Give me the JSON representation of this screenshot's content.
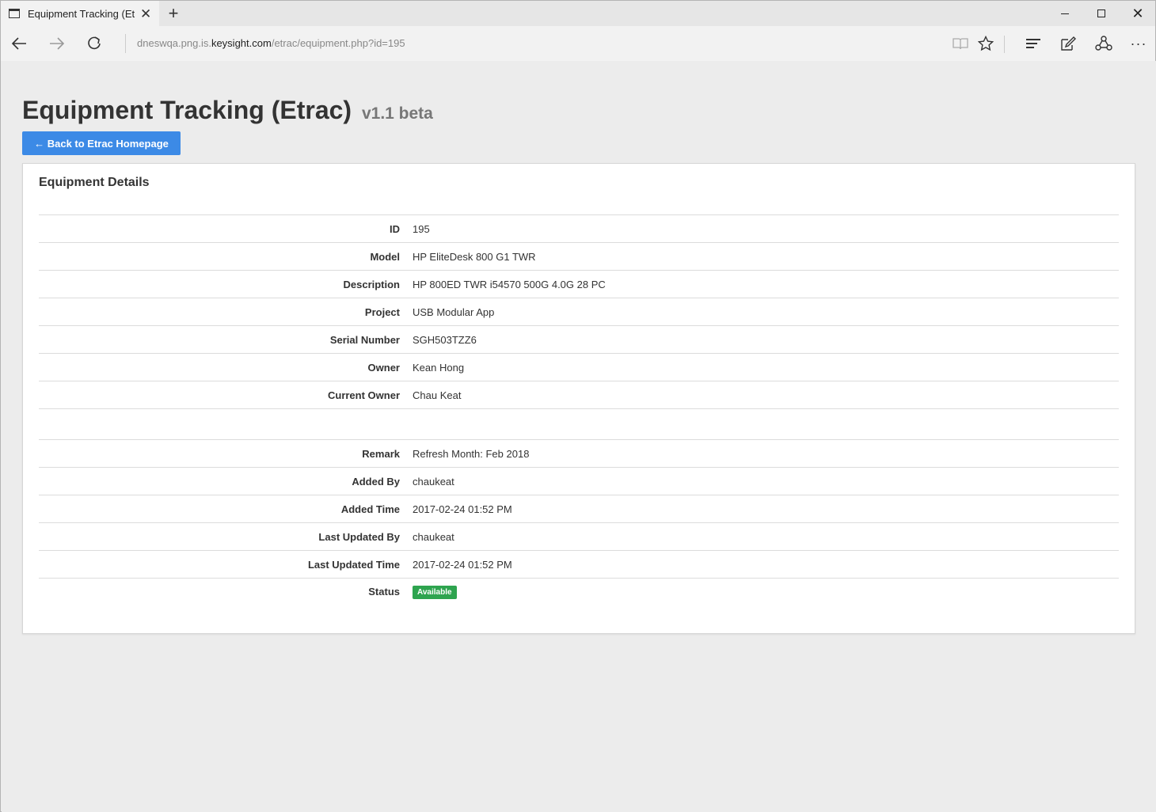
{
  "browser": {
    "tab_title": "Equipment Tracking (Etr",
    "tab_close": "✕",
    "new_tab": "+",
    "url_prefix": "dneswqa.png.is.",
    "url_domain": "keysight.com",
    "url_path": "/etrac/equipment.php?id=195"
  },
  "header": {
    "title": "Equipment Tracking (Etrac)",
    "version": "v1.1 beta",
    "back_button": "← Back to Etrac Homepage"
  },
  "panel": {
    "title": "Equipment Details",
    "rows": [
      {
        "label": "ID",
        "value": "195"
      },
      {
        "label": "Model",
        "value": "HP EliteDesk 800 G1 TWR"
      },
      {
        "label": "Description",
        "value": "HP 800ED TWR i54570 500G 4.0G 28 PC"
      },
      {
        "label": "Project",
        "value": "USB Modular App"
      },
      {
        "label": "Serial Number",
        "value": "SGH503TZZ6"
      },
      {
        "label": "Owner",
        "value": "Kean Hong"
      },
      {
        "label": "Current Owner",
        "value": "Chau Keat"
      },
      {
        "label": "",
        "value": ""
      },
      {
        "label": "Remark",
        "value": "Refresh Month: Feb 2018"
      },
      {
        "label": "Added By",
        "value": "chaukeat"
      },
      {
        "label": "Added Time",
        "value": "2017-02-24 01:52 PM"
      },
      {
        "label": "Last Updated By",
        "value": "chaukeat"
      },
      {
        "label": "Last Updated Time",
        "value": "2017-02-24 01:52 PM"
      },
      {
        "label": "Status",
        "value": "Available"
      }
    ],
    "status_color": "#2ea44f"
  },
  "colors": {
    "accent": "#3c8ae6",
    "page_bg": "#ececec"
  }
}
